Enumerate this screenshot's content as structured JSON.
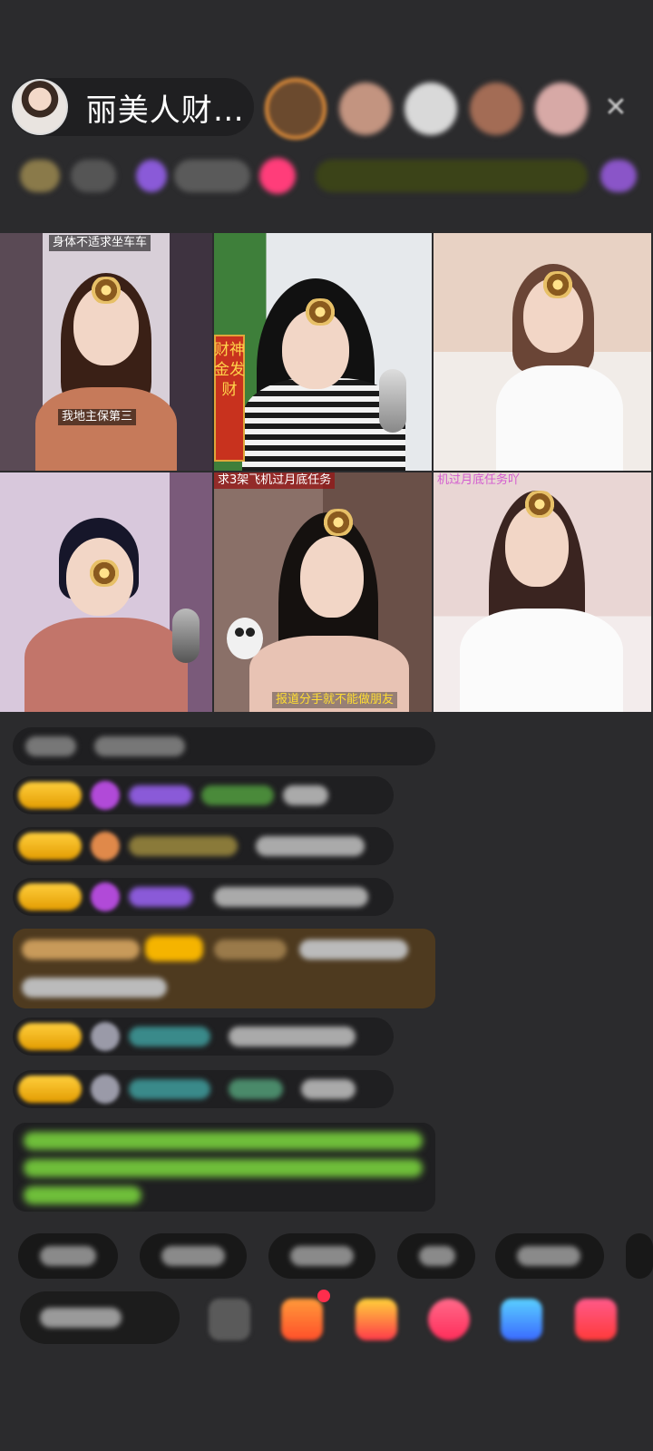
{
  "header": {
    "host_name": "丽美人财…",
    "close_icon": "close-icon"
  },
  "video_captions": {
    "c1_top": "身体不适求坐车车",
    "c1_bottom": "我地主保第三",
    "c2_banner": "财神金发财",
    "c4_top": "求3架飞机过月底任务",
    "c4_bottom": "报道分手就不能做朋友",
    "c5_top": "机过月底任务吖"
  },
  "colors": {
    "background": "#2b2b2d",
    "chat_bubble": "#1f1f21",
    "highlight_row": "#4e3a1f",
    "level_badge": "#f5b400",
    "green_text": "#6fbf3a"
  },
  "icons": {
    "host_avatar": "avatar",
    "gift": "gift-icon",
    "heart": "heart-icon",
    "menu": "menu-icon"
  }
}
